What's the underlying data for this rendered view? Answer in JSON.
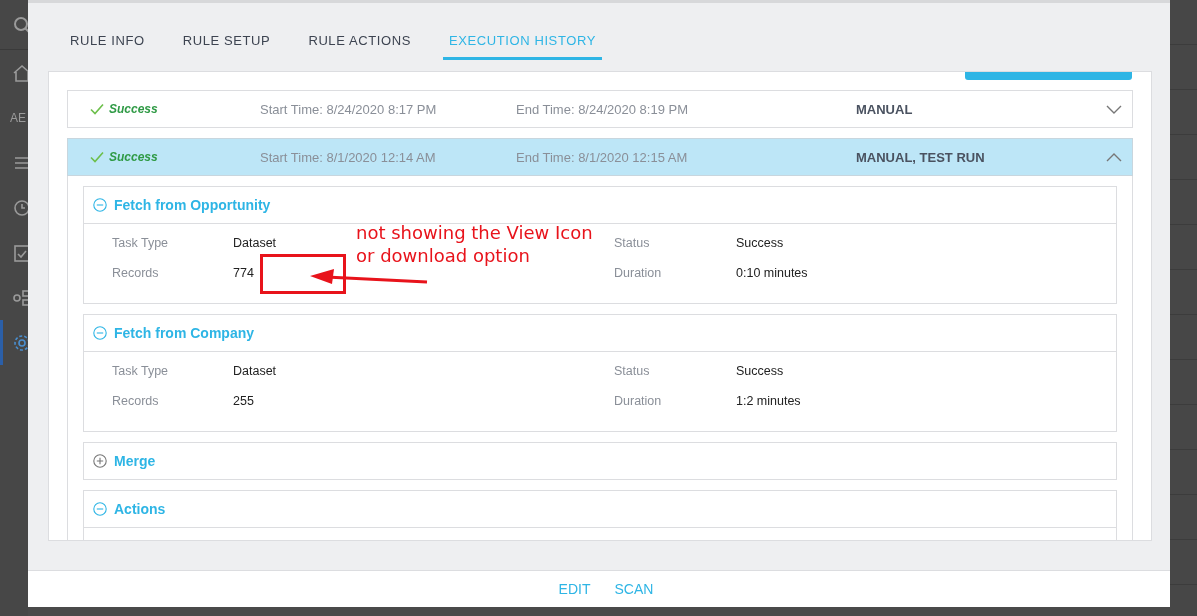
{
  "sidebar": {
    "label": "AE"
  },
  "tabs": [
    {
      "label": "RULE INFO",
      "selected": false
    },
    {
      "label": "RULE SETUP",
      "selected": false
    },
    {
      "label": "RULE ACTIONS",
      "selected": false
    },
    {
      "label": "EXECUTION HISTORY",
      "selected": true
    }
  ],
  "runs": [
    {
      "status": "Success",
      "start": "Start Time: 8/24/2020 8:17 PM",
      "end": "End Time: 8/24/2020 8:19 PM",
      "trigger": "MANUAL",
      "expanded": false
    },
    {
      "status": "Success",
      "start": "Start Time: 8/1/2020 12:14 AM",
      "end": "End Time: 8/1/2020 12:15 AM",
      "trigger": "MANUAL, TEST RUN",
      "expanded": true,
      "tasks": [
        {
          "title": "Fetch from Opportunity",
          "expanded": true,
          "fields": [
            {
              "label": "Task Type",
              "value": "Dataset"
            },
            {
              "label": "Status",
              "value": "Success"
            },
            {
              "label": "Records",
              "value": "774"
            },
            {
              "label": "Duration",
              "value": "0:10 minutes"
            }
          ]
        },
        {
          "title": "Fetch from Company",
          "expanded": true,
          "fields": [
            {
              "label": "Task Type",
              "value": "Dataset"
            },
            {
              "label": "Status",
              "value": "Success"
            },
            {
              "label": "Records",
              "value": "255"
            },
            {
              "label": "Duration",
              "value": "1:2 minutes"
            }
          ]
        },
        {
          "title": "Merge",
          "expanded": false
        },
        {
          "title": "Actions",
          "expanded": true
        }
      ]
    }
  ],
  "annotation": {
    "lines": [
      "not showing the View Icon",
      "or download option"
    ]
  },
  "footer": {
    "buttons": [
      "EDIT",
      "SCAN"
    ]
  }
}
